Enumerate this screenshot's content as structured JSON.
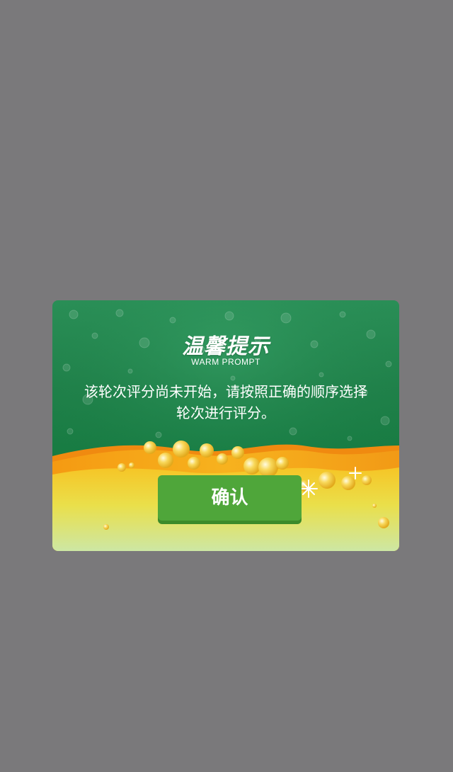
{
  "dialog": {
    "title": "温馨提示",
    "subtitle": "WARM PROMPT",
    "message": "该轮次评分尚未开始，请按照正确的顺序选择轮次进行评分。",
    "confirm_label": "确认"
  },
  "colors": {
    "overlay": "#7a797b",
    "dialog_green": "#1f8049",
    "wave_orange": "#f7a21b",
    "wave_yellow": "#f3d63a",
    "button_green": "#4fa63a"
  }
}
